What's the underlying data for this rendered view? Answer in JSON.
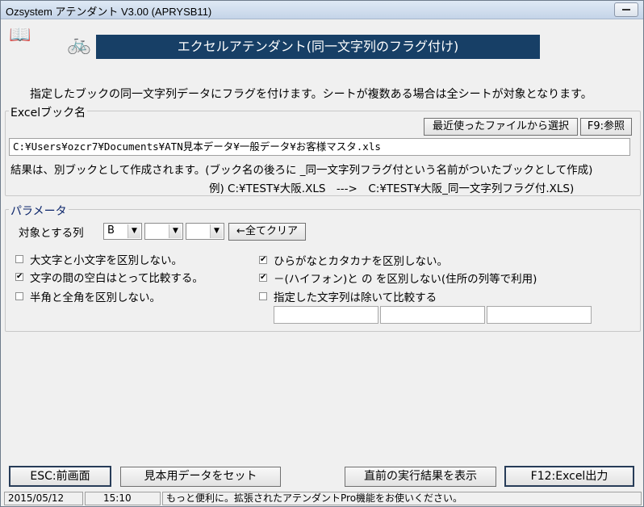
{
  "window": {
    "title": "Ozsystem アテンダント V3.00 (APRYSB11)"
  },
  "banner": "エクセルアテンダント(同一文字列のフラグ付け)",
  "icons": {
    "book": "book-icon",
    "bike": "bicycle-icon"
  },
  "description": "指定したブックの同一文字列データにフラグを付けます。シートが複数ある場合は全シートが対象となります。",
  "excel": {
    "legend": "Excelブック名",
    "recent_button": "最近使ったファイルから選択",
    "browse_button": "F9:参照",
    "path_value": "C:¥Users¥ozcr7¥Documents¥ATN見本データ¥一般データ¥お客様マスタ.xls",
    "note": "結果は、別ブックとして作成されます。(ブック名の後ろに _同一文字列フラグ付という名前がついたブックとして作成)",
    "example": "例) C:¥TEST¥大阪.XLS　--->　C:¥TEST¥大阪_同一文字列フラグ付.XLS)"
  },
  "params": {
    "legend": "パラメータ",
    "columns_label": "対象とする列",
    "col1": "B",
    "col2": "",
    "col3": "",
    "clear_button": "←全てクリア",
    "opt_case": "大文字と小文字を区別しない。",
    "opt_space": "文字の間の空白はとって比較する。",
    "opt_width": "半角と全角を区別しない。",
    "opt_kana": "ひらがなとカタカナを区別しない。",
    "opt_hyphen": "－(ハイフォン)と の を区別しない(住所の列等で利用)",
    "opt_exclude": "指定した文字列は除いて比較する",
    "checked_case": false,
    "checked_space": true,
    "checked_width": false,
    "checked_kana": true,
    "checked_hyphen": true,
    "checked_exclude": false
  },
  "buttons": {
    "esc": "ESC:前画面",
    "sample": "見本用データをセット",
    "last_result": "直前の実行結果を表示",
    "f12": "F12:Excel出力"
  },
  "status": {
    "date": "2015/05/12",
    "time": "15:10",
    "message": "もっと便利に。拡張されたアテンダントPro機能をお使いください。"
  }
}
